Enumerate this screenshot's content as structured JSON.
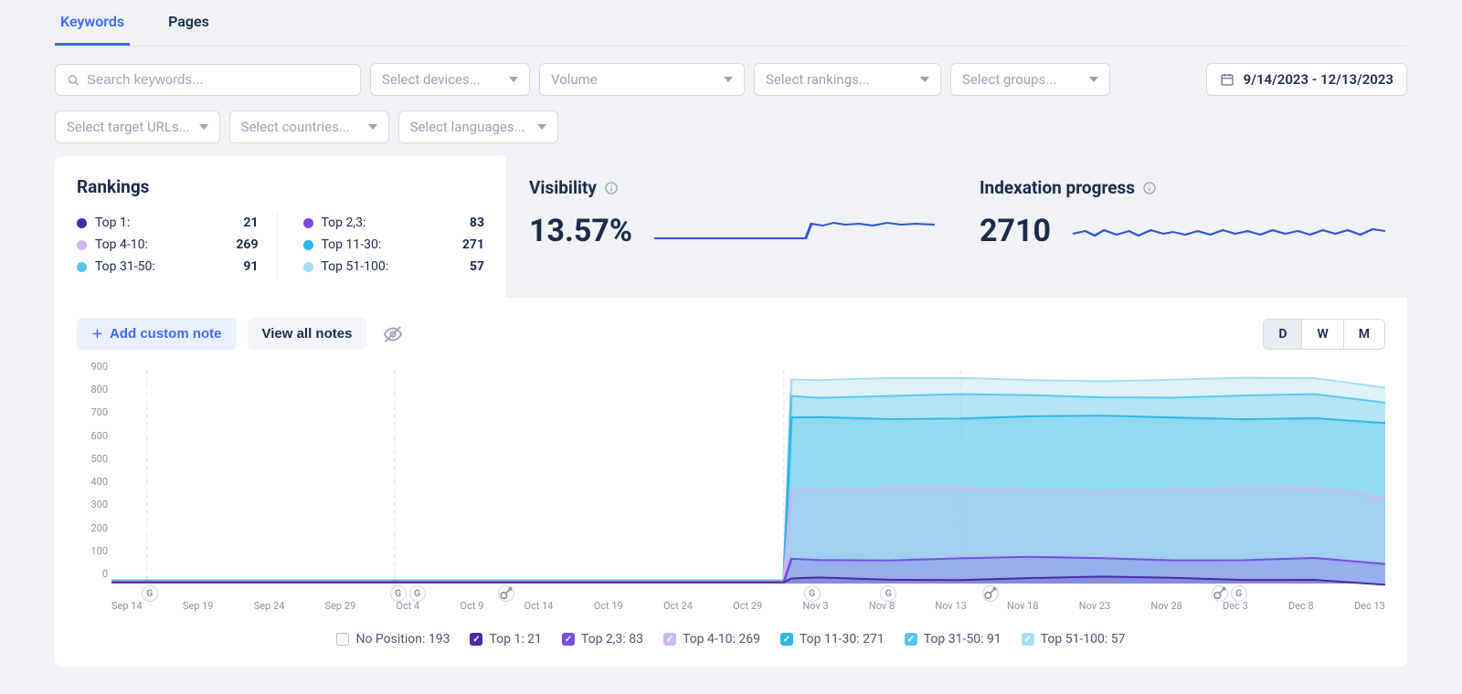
{
  "tabs": {
    "keywords": "Keywords",
    "pages": "Pages",
    "active": "keywords"
  },
  "filters": {
    "search_placeholder": "Search keywords...",
    "devices": "Select devices...",
    "volume": "Volume",
    "rankings": "Select rankings...",
    "groups": "Select groups...",
    "target_urls": "Select target URLs...",
    "countries": "Select countries...",
    "languages": "Select languages...",
    "date_range": "9/14/2023 - 12/13/2023"
  },
  "colors": {
    "top1": "#4b2aa3",
    "top23": "#7a4de0",
    "top4_10": "#cdb6ef",
    "top11_30": "#2fb6e8",
    "top31_50": "#57c8ed",
    "top51_100": "#a6def2",
    "sparkline": "#2b57d6"
  },
  "rankings": {
    "title": "Rankings",
    "items_left": [
      {
        "key": "top1",
        "label": "Top 1:",
        "value": "21"
      },
      {
        "key": "top4_10",
        "label": "Top 4-10:",
        "value": "269"
      },
      {
        "key": "top31_50",
        "label": "Top 31-50:",
        "value": "91"
      }
    ],
    "items_right": [
      {
        "key": "top23",
        "label": "Top 2,3:",
        "value": "83"
      },
      {
        "key": "top11_30",
        "label": "Top 11-30:",
        "value": "271"
      },
      {
        "key": "top51_100",
        "label": "Top 51-100:",
        "value": "57"
      }
    ]
  },
  "visibility": {
    "title": "Visibility",
    "value": "13.57%"
  },
  "indexation": {
    "title": "Indexation progress",
    "value": "2710"
  },
  "chart_toolbar": {
    "add_note": "Add custom note",
    "view_notes": "View all notes",
    "dwm": {
      "D": "D",
      "W": "W",
      "M": "M",
      "active": "D"
    }
  },
  "chart_data": {
    "type": "area",
    "ylabel": "",
    "ylim": [
      0,
      900
    ],
    "y_ticks": [
      0,
      100,
      200,
      300,
      400,
      500,
      600,
      700,
      800,
      900
    ],
    "x_ticks": [
      "Sep 14",
      "Sep 19",
      "Sep 24",
      "Sep 29",
      "Oct 4",
      "Oct 9",
      "Oct 14",
      "Oct 19",
      "Oct 24",
      "Oct 29",
      "Nov 3",
      "Nov 8",
      "Nov 13",
      "Nov 18",
      "Nov 23",
      "Nov 28",
      "Dec 3",
      "Dec 8",
      "Dec 13"
    ],
    "break_index": 9.5,
    "series": [
      {
        "name": "Top 1",
        "key": "top1",
        "before": 5,
        "after": 21
      },
      {
        "name": "Top 2,3",
        "key": "top23",
        "before": 5,
        "after": 104,
        "end_value": 83
      },
      {
        "name": "Top 4-10",
        "key": "top4_10",
        "before": 8,
        "after": 395,
        "end_value": 269
      },
      {
        "name": "Top 11-30",
        "key": "top11_30",
        "before": 12,
        "after": 700,
        "end_value": 271
      },
      {
        "name": "Top 31-50",
        "key": "top31_50",
        "before": 12,
        "after": 790,
        "end_value": 91
      },
      {
        "name": "Top 51-100",
        "key": "top51_100",
        "before": 12,
        "after": 860,
        "end_value": 57
      }
    ],
    "markers": [
      {
        "icon": "G",
        "x_frac": 0.03
      },
      {
        "icon": "G",
        "x_frac": 0.225
      },
      {
        "icon": "G",
        "x_frac": 0.24
      },
      {
        "icon": "key",
        "x_frac": 0.31
      },
      {
        "icon": "G",
        "x_frac": 0.55
      },
      {
        "icon": "G",
        "x_frac": 0.61
      },
      {
        "icon": "key",
        "x_frac": 0.69
      },
      {
        "icon": "key",
        "x_frac": 0.87
      },
      {
        "icon": "G",
        "x_frac": 0.885
      }
    ]
  },
  "legend": {
    "items": [
      {
        "key": "none",
        "label": "No Position: 193",
        "box_type": "outline"
      },
      {
        "key": "top1",
        "label": "Top 1: 21"
      },
      {
        "key": "top23",
        "label": "Top 2,3: 83"
      },
      {
        "key": "top4_10",
        "label": "Top 4-10: 269"
      },
      {
        "key": "top11_30",
        "label": "Top 11-30: 271"
      },
      {
        "key": "top31_50",
        "label": "Top 31-50: 91"
      },
      {
        "key": "top51_100",
        "label": "Top 51-100: 57"
      }
    ]
  }
}
